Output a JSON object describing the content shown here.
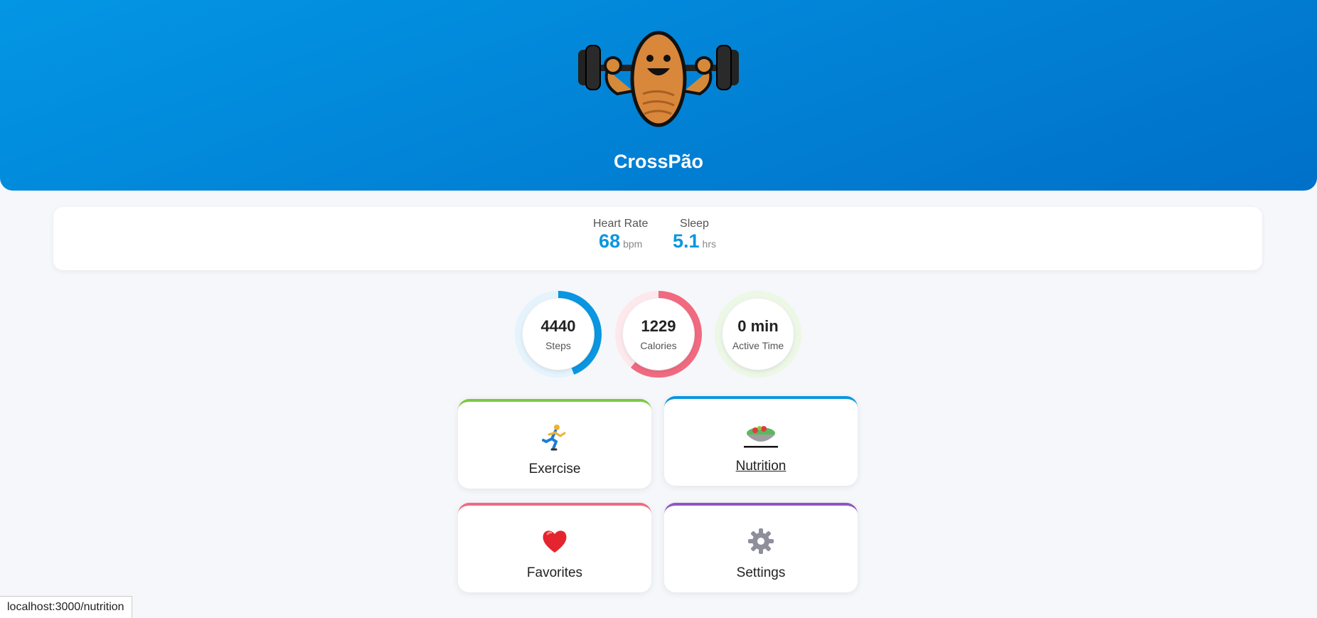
{
  "app": {
    "title": "CrossPão"
  },
  "stats": {
    "heart_rate": {
      "label": "Heart Rate",
      "value": "68",
      "unit": "bpm"
    },
    "sleep": {
      "label": "Sleep",
      "value": "5.1",
      "unit": "hrs"
    }
  },
  "rings": [
    {
      "value": "4440",
      "label": "Steps",
      "progress": 0.44,
      "color": "#0a96e0",
      "track": "#e4f3fc"
    },
    {
      "value": "1229",
      "label": "Calories",
      "progress": 0.61,
      "color": "#f06a80",
      "track": "#fde8ec"
    },
    {
      "value": "0 min",
      "label": "Active Time",
      "progress": 0,
      "color": "#7bc943",
      "track": "#edf7e6"
    }
  ],
  "tiles": [
    {
      "label": "Exercise",
      "icon": "running-person-icon",
      "accent": "#7bc943"
    },
    {
      "label": "Nutrition",
      "icon": "salad-bowl-icon",
      "accent": "#0a96e0"
    },
    {
      "label": "Favorites",
      "icon": "heart-icon",
      "accent": "#f06a80"
    },
    {
      "label": "Settings",
      "icon": "gear-icon",
      "accent": "#8e57c2"
    }
  ],
  "status_bar": {
    "url": "localhost:3000/nutrition"
  }
}
